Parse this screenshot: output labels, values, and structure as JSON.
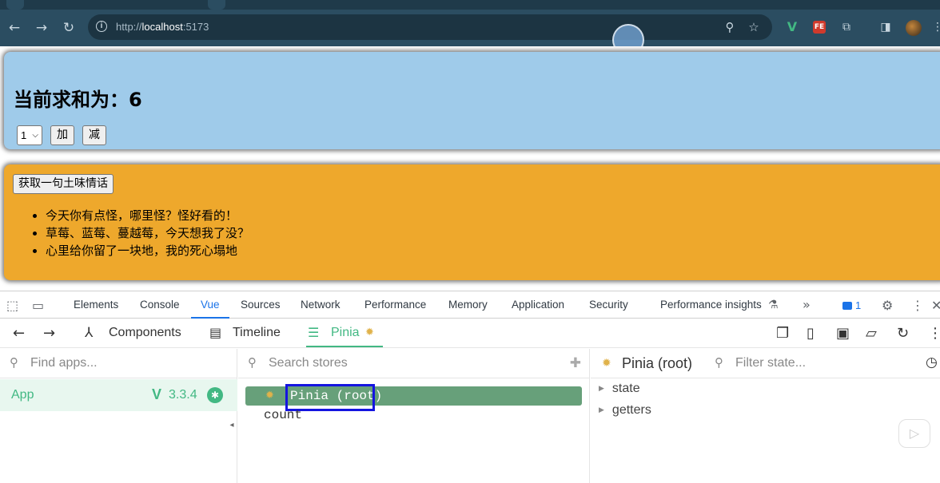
{
  "browser": {
    "url_host": "http://",
    "url_main": "localhost",
    "url_port": ":5173",
    "nav": {
      "back": "←",
      "forward": "→",
      "reload": "↻"
    },
    "icons": [
      "zoom-icon",
      "star-icon",
      "vue-ext-icon",
      "fe-ext-icon",
      "puzzle-icon",
      "sidebar-icon",
      "avatar",
      "menu-icon"
    ],
    "ext_fe_label": "FE",
    "ext_v_label": "V"
  },
  "sum_card": {
    "heading": "当前求和为：6",
    "select_value": "1",
    "add_label": "加",
    "sub_label": "减",
    "bg_color": "#9fcbea"
  },
  "talk_card": {
    "button_label": "获取一句土味情话",
    "items": [
      "今天你有点怪，哪里怪？怪好看的！",
      "草莓、蓝莓、蔓越莓，今天想我了没？",
      "心里给你留了一块地，我的死心塌地"
    ],
    "bg_color": "#eea82c"
  },
  "devtools": {
    "tabs": [
      "Elements",
      "Console",
      "Vue",
      "Sources",
      "Network",
      "Performance",
      "Memory",
      "Application",
      "Security",
      "Performance insights"
    ],
    "active_tab": "Vue",
    "more_label": "»",
    "issues_count": "1"
  },
  "vue_devtools": {
    "tabs": {
      "components": "Components",
      "timeline": "Timeline",
      "pinia": "Pinia"
    },
    "active_tab": "Pinia",
    "find_apps_placeholder": "Find apps...",
    "app_name": "App",
    "app_version": "3.3.4",
    "search_stores_placeholder": "Search stores",
    "selected_store": "Pinia (root)",
    "stores": [
      "count"
    ],
    "inspector_title": "Pinia (root)",
    "filter_state_placeholder": "Filter state...",
    "tree": [
      "state",
      "getters"
    ],
    "accent": "#42b883"
  }
}
